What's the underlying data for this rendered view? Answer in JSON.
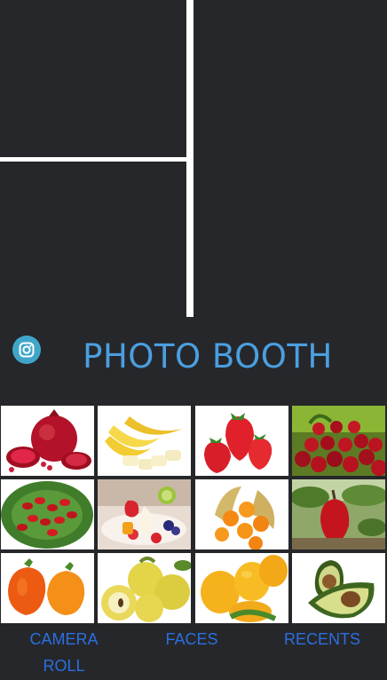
{
  "app": {
    "title": "PHOTO BOOTH"
  },
  "instagram": {
    "icon": "instagram-icon",
    "color": "#3fa6c9"
  },
  "accent": "#4a9fe0",
  "link_color": "#2a6fe0",
  "photos": [
    {
      "subject": "pomegranate",
      "icon": "pomegranate-photo"
    },
    {
      "subject": "bananas",
      "icon": "banana-photo"
    },
    {
      "subject": "strawberries",
      "icon": "strawberry-photo"
    },
    {
      "subject": "cherries",
      "icon": "cherry-photo"
    },
    {
      "subject": "red berries with leaves",
      "icon": "berries-photo"
    },
    {
      "subject": "fruit dessert",
      "icon": "fruit-dessert-photo"
    },
    {
      "subject": "physalis",
      "icon": "physalis-photo"
    },
    {
      "subject": "red fruit on tree",
      "icon": "red-fruit-photo"
    },
    {
      "subject": "orange fruits",
      "icon": "orange-fruit-photo"
    },
    {
      "subject": "quinces",
      "icon": "quince-photo"
    },
    {
      "subject": "mangoes",
      "icon": "mango-photo"
    },
    {
      "subject": "avocado",
      "icon": "avocado-photo"
    }
  ],
  "tabs": {
    "camera_roll_line1": "CAMERA",
    "camera_roll_line2": "ROLL",
    "faces": "FACES",
    "recents": "RECENTS"
  }
}
